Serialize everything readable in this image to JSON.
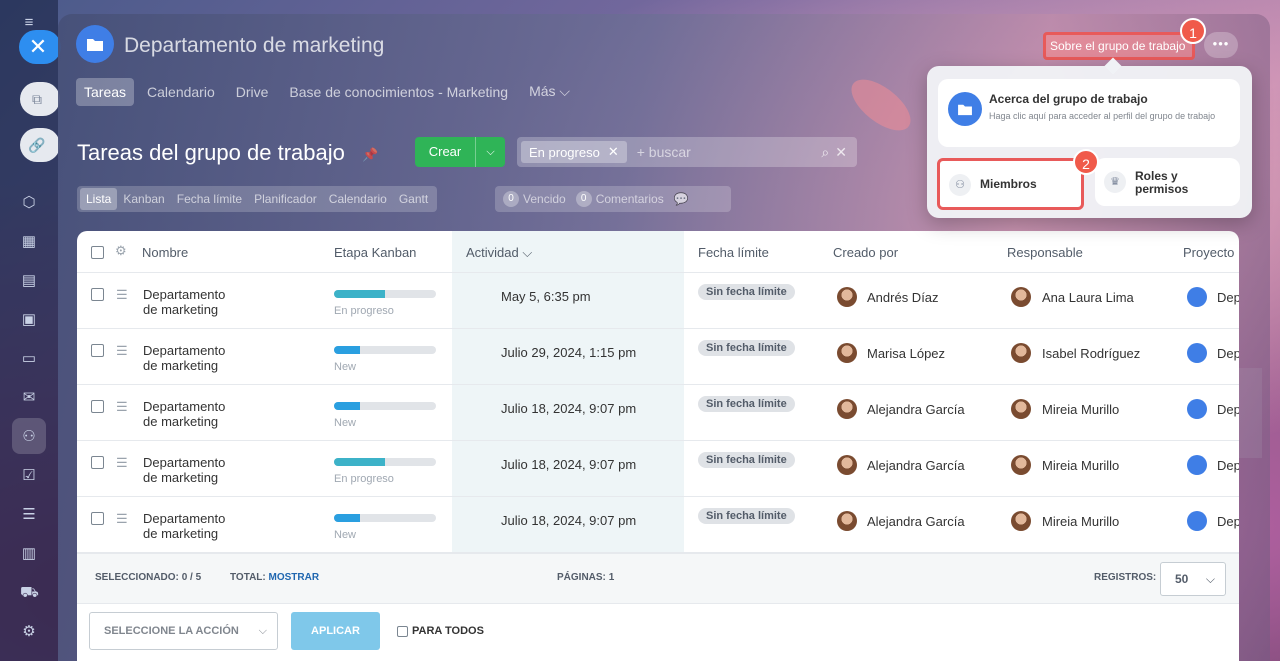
{
  "window": {
    "title": "Departamento de marketing"
  },
  "header": {
    "about_button": "Sobre el grupo de trabajo",
    "more_label": "•••",
    "badge1": "1",
    "badge2": "2"
  },
  "nav": {
    "tabs": [
      {
        "label": "Tareas"
      },
      {
        "label": "Calendario"
      },
      {
        "label": "Drive"
      },
      {
        "label": "Base de conocimientos - Marketing"
      },
      {
        "label": "Más ⌵"
      }
    ]
  },
  "toolbar": {
    "section_title": "Tareas del grupo de trabajo",
    "create_label": "Crear",
    "filter_chip": "En progreso",
    "search_placeholder": "+ buscar"
  },
  "views": {
    "items": [
      "Lista",
      "Kanban",
      "Fecha límite",
      "Planificador",
      "Calendario",
      "Gantt"
    ]
  },
  "counters": {
    "overdue_count": "0",
    "overdue_label": "Vencido",
    "comments_count": "0",
    "comments_label": "Comentarios"
  },
  "grid": {
    "columns": [
      "Nombre",
      "Etapa Kanban",
      "Actividad ⌵",
      "Fecha límite",
      "Creado por",
      "Responsable",
      "Proyecto"
    ],
    "rows": [
      {
        "name1": "Departamento",
        "name2": "de marketing",
        "stage": "En progreso",
        "progress": 0.5,
        "activity": "May 5, 6:35 pm",
        "deadline": "Sin fecha límite",
        "creator": "Andrés Díaz",
        "responsible": "Ana Laura Lima",
        "project": "Dep"
      },
      {
        "name1": "Departamento",
        "name2": "de marketing",
        "stage": "New",
        "progress": 0.25,
        "activity": "Julio 29, 2024, 1:15 pm",
        "deadline": "Sin fecha límite",
        "creator": "Marisa López",
        "responsible": "Isabel Rodríguez",
        "project": "Dep"
      },
      {
        "name1": "Departamento",
        "name2": "de marketing",
        "stage": "New",
        "progress": 0.25,
        "activity": "Julio 18, 2024, 9:07 pm",
        "deadline": "Sin fecha límite",
        "creator": "Alejandra García",
        "responsible": "Mireia Murillo",
        "project": "Dep"
      },
      {
        "name1": "Departamento",
        "name2": "de marketing",
        "stage": "En progreso",
        "progress": 0.5,
        "activity": "Julio 18, 2024, 9:07 pm",
        "deadline": "Sin fecha límite",
        "creator": "Alejandra García",
        "responsible": "Mireia Murillo",
        "project": "Dep"
      },
      {
        "name1": "Departamento",
        "name2": "de marketing",
        "stage": "New",
        "progress": 0.25,
        "activity": "Julio 18, 2024, 9:07 pm",
        "deadline": "Sin fecha límite",
        "creator": "Alejandra García",
        "responsible": "Mireia Murillo",
        "project": "Dep"
      }
    ]
  },
  "footer": {
    "selected_label": "SELECCIONADO:",
    "selected_value": "0 / 5",
    "total_label": "TOTAL:",
    "total_link": "MOSTRAR",
    "pages_label": "PÁGINAS:",
    "pages_value": "1",
    "records_label": "REGISTROS:",
    "records_value": "50"
  },
  "actionbar": {
    "select_action": "SELECCIONE LA ACCIÓN",
    "apply": "APLICAR",
    "for_all": "PARA TODOS"
  },
  "popup": {
    "about_title": "Acerca del grupo de trabajo",
    "about_desc": "Haga clic aquí para acceder al perfil del grupo de trabajo",
    "members": "Miembros",
    "roles": "Roles y permisos"
  },
  "colors": {
    "accent": "#2d8ef0",
    "create": "#2fb457",
    "highlight": "#e85a5a",
    "progress_active": "#3cb2c8",
    "progress_new": "#2a9fe0"
  }
}
